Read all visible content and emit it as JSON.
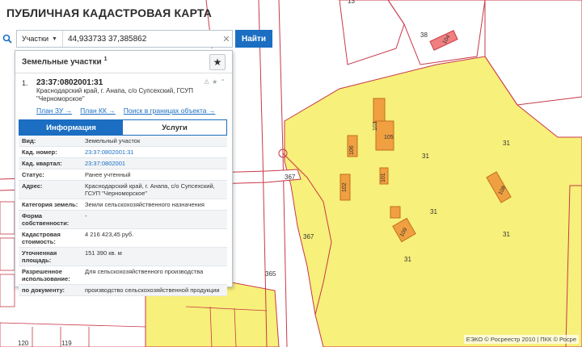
{
  "header": {
    "title": "ПУБЛИЧНАЯ КАДАСТРОВАЯ КАРТА"
  },
  "search": {
    "category": "Участки",
    "query": "44,933733 37,385862",
    "find_label": "Найти"
  },
  "panel": {
    "title": "Земельные участки",
    "count": "1",
    "result": {
      "index": "1.",
      "number": "23:37:0802001:31",
      "address": "Краснодарский край, г. Анапа, с/о Супсехский, ГСУП \"Черноморское\"",
      "links": [
        "План ЗУ →",
        "План КК →",
        "Поиск в границах объекта →"
      ]
    },
    "tabs": [
      "Информация",
      "Услуги"
    ],
    "info": [
      {
        "key": "Вид:",
        "value": "Земельный участок"
      },
      {
        "key": "Кад. номер:",
        "value": "23:37:0802001:31"
      },
      {
        "key": "Кад. квартал:",
        "value": "23:37:0802001"
      },
      {
        "key": "Статус:",
        "value": "Ранее учтенный"
      },
      {
        "key": "Адрес:",
        "value": "Краснодарский край, г. Анапа, с/о Супсехский, ГСУП \"Черноморское\""
      },
      {
        "key": "Категория земель:",
        "value": "Земли сельскохозяйственного назначения"
      },
      {
        "key": "Форма собственности:",
        "value": "-"
      },
      {
        "key": "Кадастровая стоимость:",
        "value": "4 216 423,45 руб."
      },
      {
        "key": "Уточненная площадь:",
        "value": "151 390 кв. м"
      },
      {
        "key": "Разрешенное использование:",
        "value": "Для сельскохозяйственного производства"
      },
      {
        "key": "по документу:",
        "value": "производство сельскохозяйственной продукции"
      }
    ]
  },
  "map": {
    "labels": {
      "n13": "13",
      "n38": "38",
      "n31a": "31",
      "n31b": "31",
      "n31c": "31",
      "n31d": "31",
      "n31e": "31",
      "n367a": "367",
      "n367b": "367",
      "n365": "365",
      "n120": "120",
      "n119": "119",
      "n31top": "31"
    },
    "buildings": {
      "b104": "104",
      "b103": "103",
      "b105": "105",
      "b106": "106",
      "b101": "101",
      "b102": "102",
      "b108": "108",
      "b109": "109"
    }
  },
  "credits": "ЕЭКО © Росреестр 2010 | ПКК © Росре",
  "colors": {
    "parcel_fill": "#f7f07a",
    "boundary": "#c8384a",
    "building": "#f0a040",
    "accent": "#1b6ec2"
  }
}
